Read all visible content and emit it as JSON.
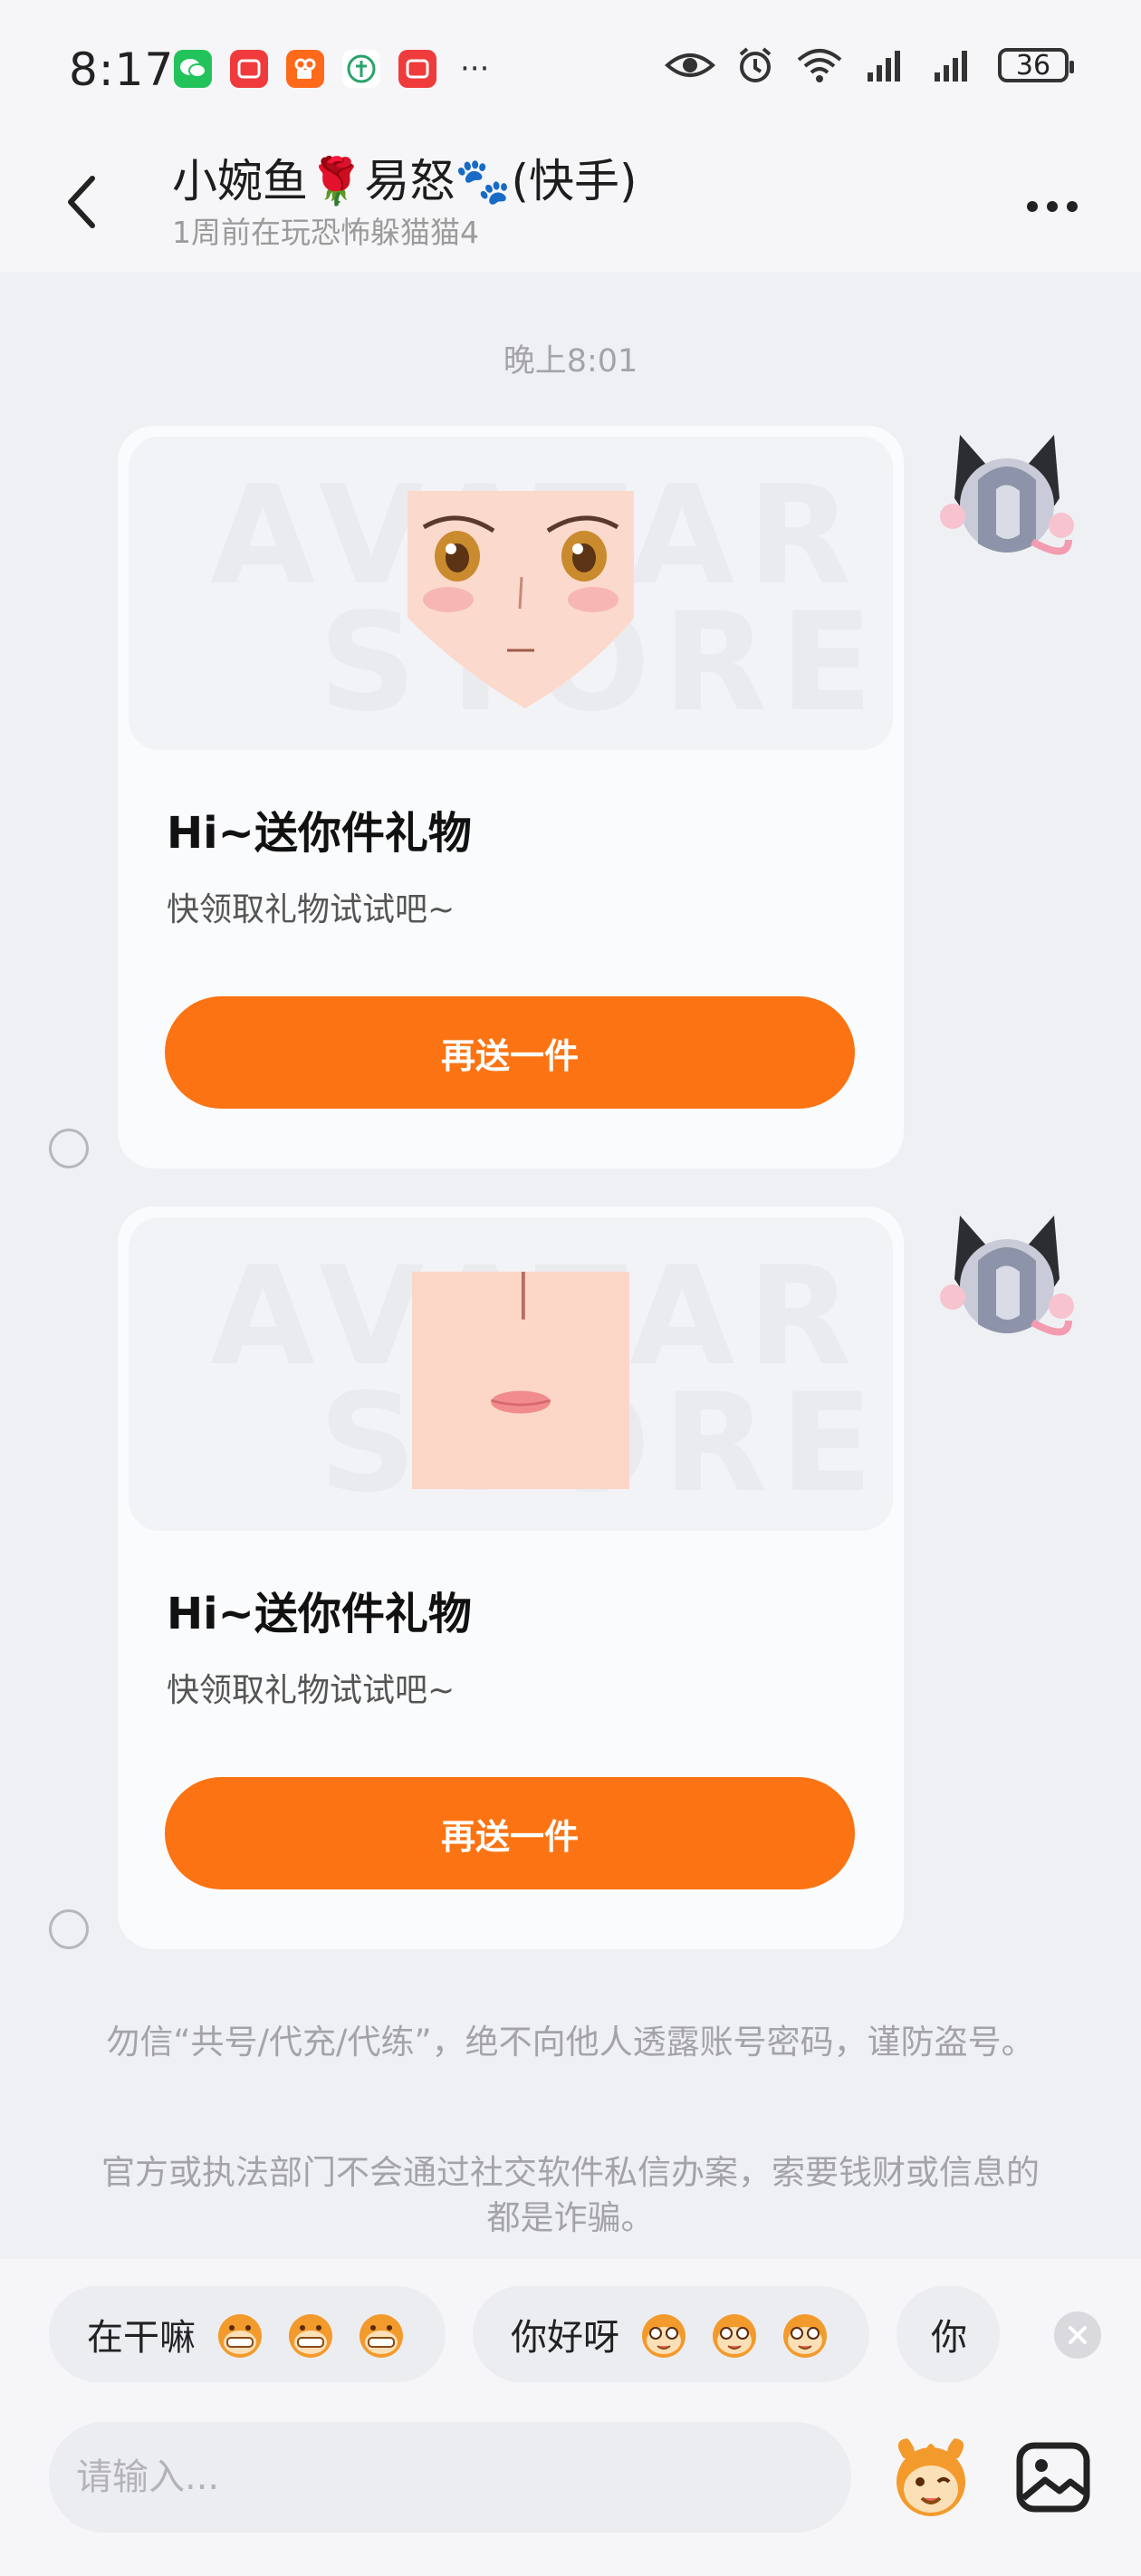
{
  "status_bar": {
    "time": "8:17",
    "battery": "36",
    "notification_icons": [
      "wechat-icon",
      "app-red-icon",
      "kuaishou-icon",
      "app-green-icon",
      "app-red-icon-2"
    ],
    "more": "···"
  },
  "header": {
    "title": "小婉鱼🌹易怒🐾(快手)",
    "subtitle": "1周前在玩恐怖躲猫猫4"
  },
  "chat": {
    "timestamp": "晚上8:01",
    "messages": [
      {
        "title": "Hi~送你件礼物",
        "desc": "快领取礼物试试吧~",
        "button": "再送一件"
      },
      {
        "title": "Hi~送你件礼物",
        "desc": "快领取礼物试试吧~",
        "button": "再送一件"
      }
    ],
    "watermark": [
      "AVATAR",
      "STORE"
    ],
    "notices": [
      "勿信“共号/代充/代练”，绝不向他人透露账号密码，谨防盗号。",
      "官方或执法部门不会通过社交软件私信办案，索要钱财或信息的都是诈骗。"
    ]
  },
  "quick_replies": [
    "在干嘛",
    "你好呀",
    "你"
  ],
  "input": {
    "placeholder": "请输入..."
  },
  "colors": {
    "accent": "#fb7312",
    "background": "#eff0f4",
    "card": "#fafbfc"
  }
}
